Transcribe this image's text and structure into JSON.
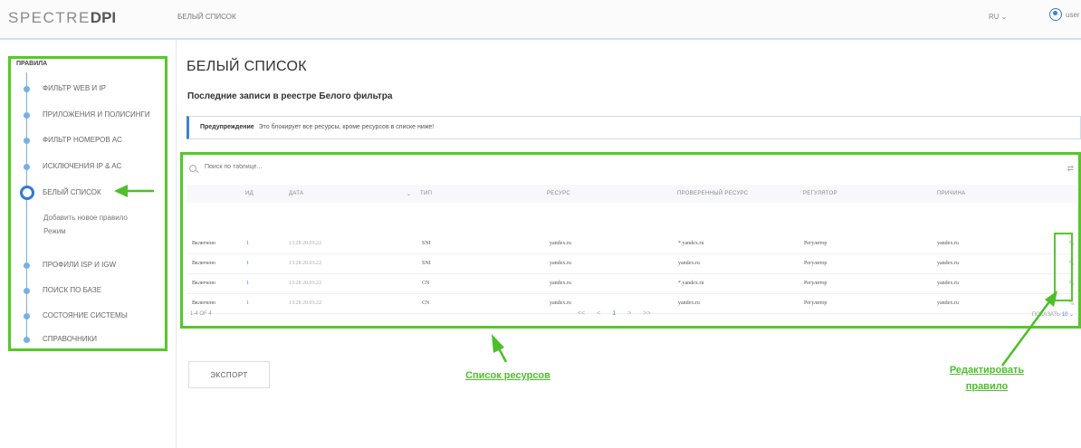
{
  "header": {
    "logo_light": "SPECTRE",
    "logo_bold": "DPI",
    "breadcrumb": "БЕЛЫЙ СПИСОК",
    "lang": "RU ⌄",
    "user": "user"
  },
  "sidebar": {
    "title": "ПРАВИЛА",
    "items": [
      {
        "label": "ФИЛЬТР WEB И IP"
      },
      {
        "label": "ПРИЛОЖЕНИЯ И ПОЛИСИНГИ"
      },
      {
        "label": "ФИЛЬТР НОМЕРОВ АС"
      },
      {
        "label": "ИСКЛЮЧЕНИЯ IP & AC"
      },
      {
        "label": "БЕЛЫЙ СПИСОК",
        "active": true
      },
      {
        "label": "ПРОФИЛИ ISP И IGW"
      },
      {
        "label": "ПОИСК ПО БАЗЕ"
      },
      {
        "label": "СОСТОЯНИЕ СИСТЕМЫ"
      },
      {
        "label": "СПРАВОЧНИКИ"
      }
    ],
    "sub_items": [
      "Добавить новое правило",
      "Режим"
    ]
  },
  "main": {
    "title": "БЕЛЫЙ СПИСОК",
    "subtitle": "Последние записи в реестре Белого фильтра",
    "warning_label": "Предупреждение",
    "warning_text": "Это блокирует все ресурсы, кроме ресурсов в списке ниже!",
    "search_placeholder": "Поиск по таблице...",
    "export_label": "ЭКСПОРТ"
  },
  "table": {
    "columns": [
      "ИД",
      "ДАТА",
      "ТИП",
      "РЕСУРС",
      "ПРОВЕРЕННЫЙ РЕСУРС",
      "РЕГУЛЯТОР",
      "ПРИЧИНА"
    ],
    "sort_indicator": "⌄",
    "rows": [
      {
        "status": "Включено",
        "id": "1",
        "date": "13:28 20.03.22",
        "type": "SNI",
        "resource": "yandex.ru",
        "checked": "*.yandex.ru",
        "regulator": "Регулятор",
        "reason": "yandex.ru"
      },
      {
        "status": "Включено",
        "id": "1",
        "date": "13:28 20.03.22",
        "type": "SNI",
        "resource": "yandex.ru",
        "checked": "yandex.ru",
        "regulator": "Регулятор",
        "reason": "yandex.ru"
      },
      {
        "status": "Включено",
        "id": "1",
        "date": "13:28 20.03.22",
        "type": "CN",
        "resource": "yandex.ru",
        "checked": "*.yandex.ru",
        "regulator": "Регулятор",
        "reason": "yandex.ru"
      },
      {
        "status": "Включено",
        "id": "1",
        "date": "13:28 20.03.22",
        "type": "CN",
        "resource": "yandex.ru",
        "checked": "yandex.ru",
        "regulator": "Регулятор",
        "reason": "yandex.ru"
      }
    ],
    "count": "1-4 OF 4",
    "pager": [
      "<<",
      "<",
      "1",
      ">",
      ">>"
    ],
    "show_label": "ПОКАЗАТЬ",
    "page_size": "10 ⌄"
  },
  "annotations": {
    "resources": "Список ресурсов",
    "edit_line1": "Редактировать",
    "edit_line2": "правило"
  },
  "colors": {
    "highlight": "#55c829",
    "accent": "#3a7fd5"
  }
}
